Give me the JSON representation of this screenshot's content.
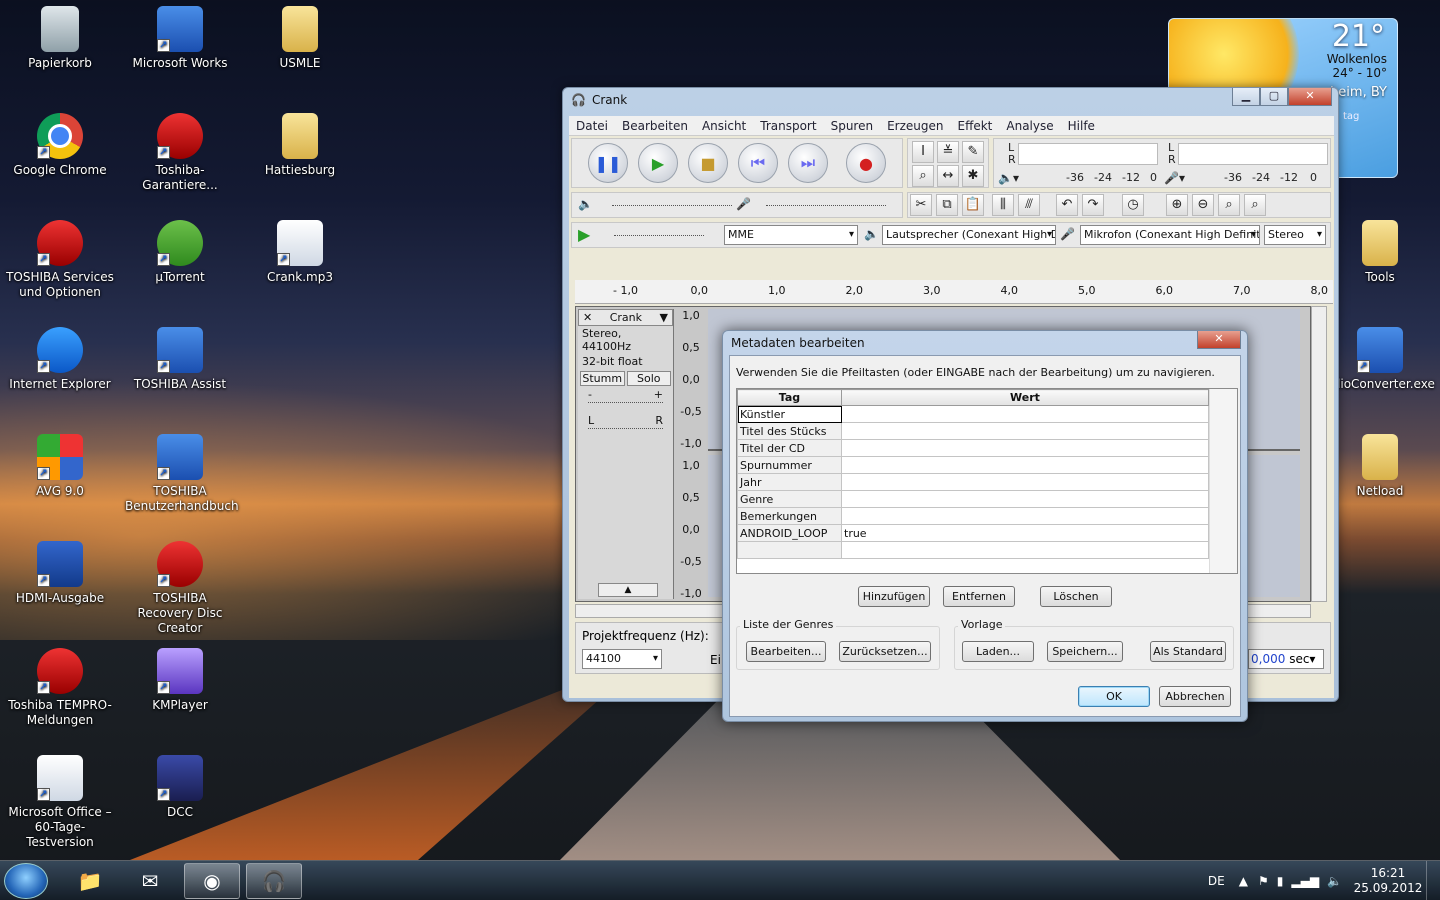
{
  "desktop": {
    "icons": [
      {
        "label": "Papierkorb",
        "icon": "recycle-bin-icon"
      },
      {
        "label": "Microsoft Works",
        "icon": "works-icon"
      },
      {
        "label": "USMLE",
        "icon": "folder-icon"
      },
      {
        "label": "Google Chrome",
        "icon": "chrome-icon"
      },
      {
        "label": "Toshiba-Garantiere...",
        "icon": "toshiba-icon"
      },
      {
        "label": "Hattiesburg",
        "icon": "folder-icon"
      },
      {
        "label": "TOSHIBA Services und Optionen",
        "icon": "toshiba-services-icon"
      },
      {
        "label": "µTorrent",
        "icon": "utorrent-icon"
      },
      {
        "label": "Crank.mp3",
        "icon": "audio-file-icon"
      },
      {
        "label": "Internet Explorer",
        "icon": "ie-icon"
      },
      {
        "label": "TOSHIBA Assist",
        "icon": "assist-icon"
      },
      {
        "label": "AVG 9.0",
        "icon": "avg-icon"
      },
      {
        "label": "TOSHIBA Benutzerhandbuch",
        "icon": "manual-icon"
      },
      {
        "label": "HDMI-Ausgabe",
        "icon": "hdmi-icon"
      },
      {
        "label": "TOSHIBA Recovery Disc Creator",
        "icon": "recovery-icon"
      },
      {
        "label": "Toshiba TEMPRO-Meldungen",
        "icon": "tempro-icon"
      },
      {
        "label": "KMPlayer",
        "icon": "kmplayer-icon"
      },
      {
        "label": "Microsoft Office – 60-Tage-Testversion",
        "icon": "office-icon"
      },
      {
        "label": "DCC",
        "icon": "dcc-icon"
      },
      {
        "label": "Tools",
        "icon": "folder-icon"
      },
      {
        "label": "udioConverter.exe",
        "icon": "audioconverter-icon"
      },
      {
        "label": "Netload",
        "icon": "folder-icon"
      }
    ]
  },
  "weather": {
    "temp": "21°",
    "condition": "Wolkenlos",
    "range": "24° - 10°",
    "location": "heim, BY",
    "partial": "tag"
  },
  "audacity": {
    "title": "Crank",
    "menu": [
      "Datei",
      "Bearbeiten",
      "Ansicht",
      "Transport",
      "Spuren",
      "Erzeugen",
      "Effekt",
      "Analyse",
      "Hilfe"
    ],
    "meter_labels": {
      "l": "L",
      "r": "R",
      "ticks": [
        "-36",
        "-24",
        "-12",
        "0"
      ]
    },
    "host": "MME",
    "output": "Lautsprecher (Conexant High D",
    "input": "Mikrofon (Conexant High Definit",
    "channels": "Stereo",
    "ruler": [
      "- 1,0",
      "0,0",
      "1,0",
      "2,0",
      "3,0",
      "4,0",
      "5,0",
      "6,0",
      "7,0",
      "8,0"
    ],
    "track": {
      "name": "Crank",
      "info1": "Stereo, 44100Hz",
      "info2": "32-bit float",
      "mute": "Stumm",
      "solo": "Solo",
      "pan_l": "L",
      "pan_r": "R",
      "gain_minus": "-",
      "gain_plus": "+"
    },
    "scale": [
      "1,0",
      "0,5",
      "0,0",
      "-0,5",
      "-1,0"
    ],
    "rate_label": "Projektfrequenz (Hz):",
    "rate": "44100",
    "partial_e": "Ei",
    "sec_value": "0,000",
    "sec_unit": "sec"
  },
  "dialog": {
    "title": "Metadaten bearbeiten",
    "hint": "Verwenden Sie die Pfeiltasten (oder EINGABE nach der Bearbeitung) um zu navigieren.",
    "col_tag": "Tag",
    "col_value": "Wert",
    "rows": [
      {
        "tag": "Künstler",
        "value": ""
      },
      {
        "tag": "Titel des Stücks",
        "value": ""
      },
      {
        "tag": "Titel der CD",
        "value": ""
      },
      {
        "tag": "Spurnummer",
        "value": ""
      },
      {
        "tag": "Jahr",
        "value": ""
      },
      {
        "tag": "Genre",
        "value": ""
      },
      {
        "tag": "Bemerkungen",
        "value": ""
      },
      {
        "tag": "ANDROID_LOOP",
        "value": "true"
      },
      {
        "tag": "",
        "value": ""
      }
    ],
    "btn_add": "Hinzufügen",
    "btn_remove": "Entfernen",
    "btn_clear": "Löschen",
    "genres_label": "Liste der Genres",
    "btn_edit": "Bearbeiten...",
    "btn_reset": "Zurücksetzen...",
    "template_label": "Vorlage",
    "btn_load": "Laden...",
    "btn_save": "Speichern...",
    "btn_default": "Als Standard",
    "btn_ok": "OK",
    "btn_cancel": "Abbrechen"
  },
  "taskbar": {
    "lang": "DE",
    "time": "16:21",
    "date": "25.09.2012"
  }
}
